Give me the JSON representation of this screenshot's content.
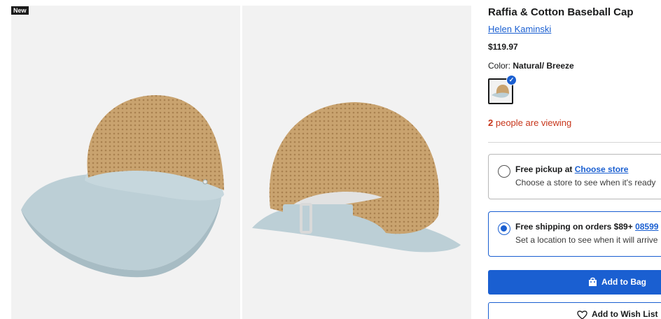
{
  "gallery": {
    "badge": "New",
    "images": [
      {
        "icon": "cap-front-view-image"
      },
      {
        "icon": "cap-back-view-image"
      }
    ]
  },
  "product": {
    "title": "Raffia & Cotton Baseball Cap",
    "brand": "Helen Kaminski",
    "price": "$119.97",
    "color_label": "Color:",
    "color_value": "Natural/ Breeze",
    "viewing_count": "2",
    "viewing_text": "people are viewing"
  },
  "fulfillment": {
    "pickup": {
      "title": "Free pickup at",
      "link": "Choose store",
      "subtitle": "Choose a store to see when it's ready",
      "selected": false
    },
    "shipping": {
      "title": "Free shipping on orders $89+",
      "link": "08599",
      "subtitle": "Set a location to see when it will arrive",
      "selected": true
    }
  },
  "actions": {
    "add_to_bag": "Add to Bag",
    "add_to_wishlist": "Add to Wish List"
  },
  "colors": {
    "accent": "#1a5fd1",
    "alert": "#c7361b",
    "raffia": "#c9a36f",
    "brim": "#bccfd6"
  }
}
